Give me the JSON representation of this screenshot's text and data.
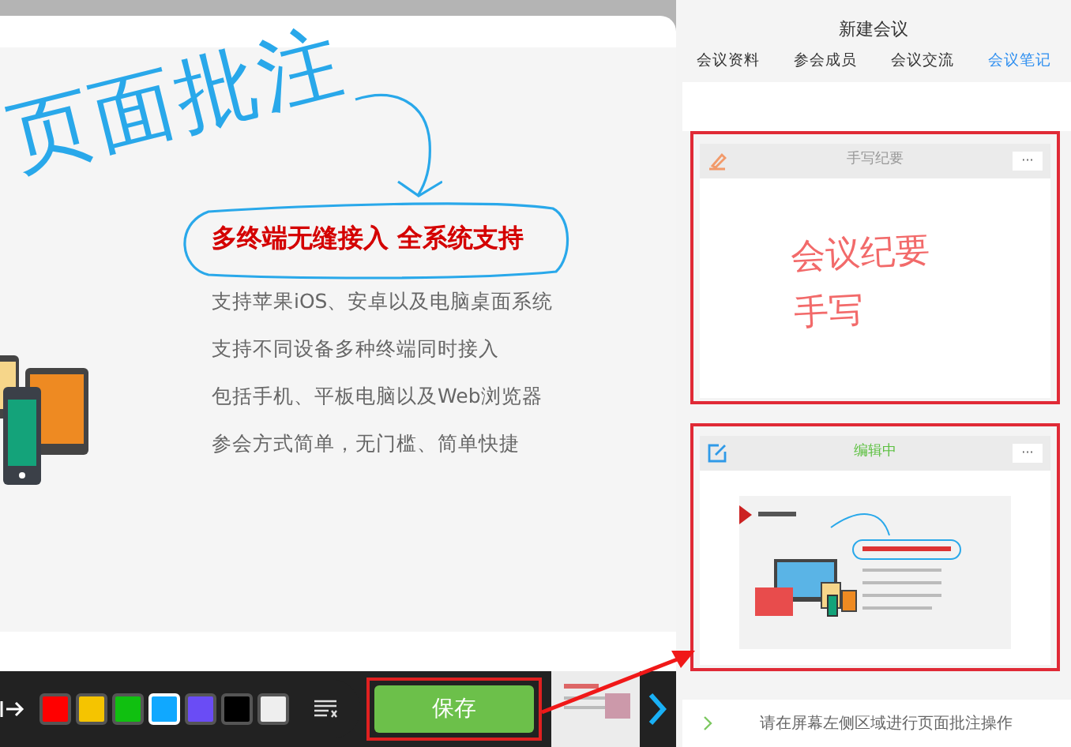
{
  "slide": {
    "annotation": "页面批注",
    "heading": "多终端无缝接入 全系统支持",
    "bullets": [
      "支持苹果iOS、安卓以及电脑桌面系统",
      "支持不同设备多种终端同时接入",
      "包括手机、平板电脑以及Web浏览器",
      "参会方式简单，无门槛、简单快捷"
    ]
  },
  "toolbar": {
    "swatches": [
      {
        "color": "#ff0000",
        "selected": false
      },
      {
        "color": "#f5c400",
        "selected": false
      },
      {
        "color": "#10c010",
        "selected": false
      },
      {
        "color": "#10a8ff",
        "selected": true
      },
      {
        "color": "#6a4cf5",
        "selected": false
      },
      {
        "color": "#000000",
        "selected": false
      },
      {
        "color": "#eeeeee",
        "selected": false
      }
    ],
    "save_button": "保存"
  },
  "panel": {
    "title": "新建会议",
    "tabs": [
      {
        "label": "会议资料",
        "selected": false
      },
      {
        "label": "参会成员",
        "selected": false
      },
      {
        "label": "会议交流",
        "selected": false
      },
      {
        "label": "会议笔记",
        "selected": true
      }
    ],
    "notes": [
      {
        "kind": "handwriting",
        "title": "手写纪要",
        "editing": false,
        "more": "···",
        "lines": [
          "会议纪要",
          "手写"
        ]
      },
      {
        "kind": "slide",
        "title": "编辑中",
        "editing": true,
        "more": "···"
      }
    ],
    "hint": "请在屏幕左侧区域进行页面批注操作"
  }
}
